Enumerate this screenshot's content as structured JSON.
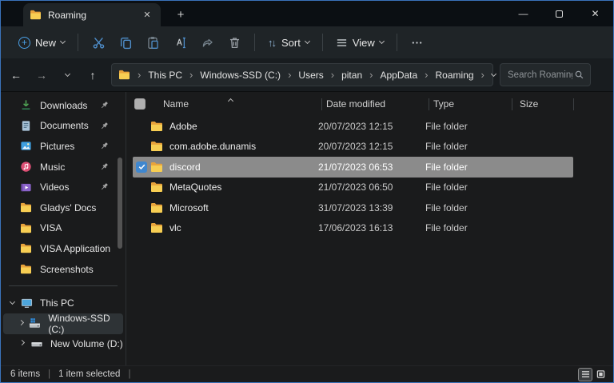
{
  "titlebar": {
    "tab_label": "Roaming"
  },
  "icons": {
    "close": "✕",
    "minimize": "—",
    "new_tab": "+",
    "back": "←",
    "forward": "→",
    "up": "↑",
    "crumb_sep": "›",
    "sort_arrows": "↑↓"
  },
  "toolbar": {
    "new_label": "New",
    "sort_label": "Sort",
    "view_label": "View"
  },
  "addressbar": {
    "crumbs": [
      "This PC",
      "Windows-SSD (C:)",
      "Users",
      "pitan",
      "AppData",
      "Roaming"
    ],
    "search_placeholder": "Search Roaming"
  },
  "sidebar": {
    "items": [
      {
        "label": "Downloads",
        "icon": "downloads-icon",
        "pinned": true
      },
      {
        "label": "Documents",
        "icon": "document-icon",
        "pinned": true
      },
      {
        "label": "Pictures",
        "icon": "pictures-icon",
        "pinned": true
      },
      {
        "label": "Music",
        "icon": "music-icon",
        "pinned": true
      },
      {
        "label": "Videos",
        "icon": "videos-icon",
        "pinned": true
      },
      {
        "label": "Gladys' Docs",
        "icon": "folder-icon",
        "pinned": false
      },
      {
        "label": "VISA",
        "icon": "folder-icon",
        "pinned": false
      },
      {
        "label": "VISA Application",
        "icon": "folder-icon",
        "pinned": false
      },
      {
        "label": "Screenshots",
        "icon": "folder-icon",
        "pinned": false
      }
    ],
    "tree": [
      {
        "label": "This PC",
        "icon": "computer-icon",
        "expanded": true
      },
      {
        "label": "Windows-SSD (C:)",
        "icon": "windows-drive-icon",
        "selected": true
      },
      {
        "label": "New Volume (D:)",
        "icon": "drive-icon",
        "selected": false
      }
    ]
  },
  "filelist": {
    "columns": [
      "Name",
      "Date modified",
      "Type",
      "Size"
    ],
    "sort": {
      "column": "Name",
      "direction": "ascending"
    },
    "rows": [
      {
        "name": "Adobe",
        "date": "20/07/2023 12:15",
        "type": "File folder",
        "size": "",
        "selected": false
      },
      {
        "name": "com.adobe.dunamis",
        "date": "20/07/2023 12:15",
        "type": "File folder",
        "size": "",
        "selected": false
      },
      {
        "name": "discord",
        "date": "21/07/2023 06:53",
        "type": "File folder",
        "size": "",
        "selected": true
      },
      {
        "name": "MetaQuotes",
        "date": "21/07/2023 06:50",
        "type": "File folder",
        "size": "",
        "selected": false
      },
      {
        "name": "Microsoft",
        "date": "31/07/2023 13:39",
        "type": "File folder",
        "size": "",
        "selected": false
      },
      {
        "name": "vlc",
        "date": "17/06/2023 16:13",
        "type": "File folder",
        "size": "",
        "selected": false
      }
    ]
  },
  "statusbar": {
    "items_text": "6 items",
    "selected_text": "1 item selected"
  },
  "colors": {
    "accent_blue": "#4aa0e6",
    "selection_gray": "#8b8b8b",
    "folder_yellow": "#f7ce53",
    "checkbox_blue": "#3f87cf",
    "window_border": "#3a73bb",
    "titlebar_bg": "#0b0f13",
    "toolbar_bg": "#1f2427",
    "content_bg": "#1a1b1c"
  }
}
